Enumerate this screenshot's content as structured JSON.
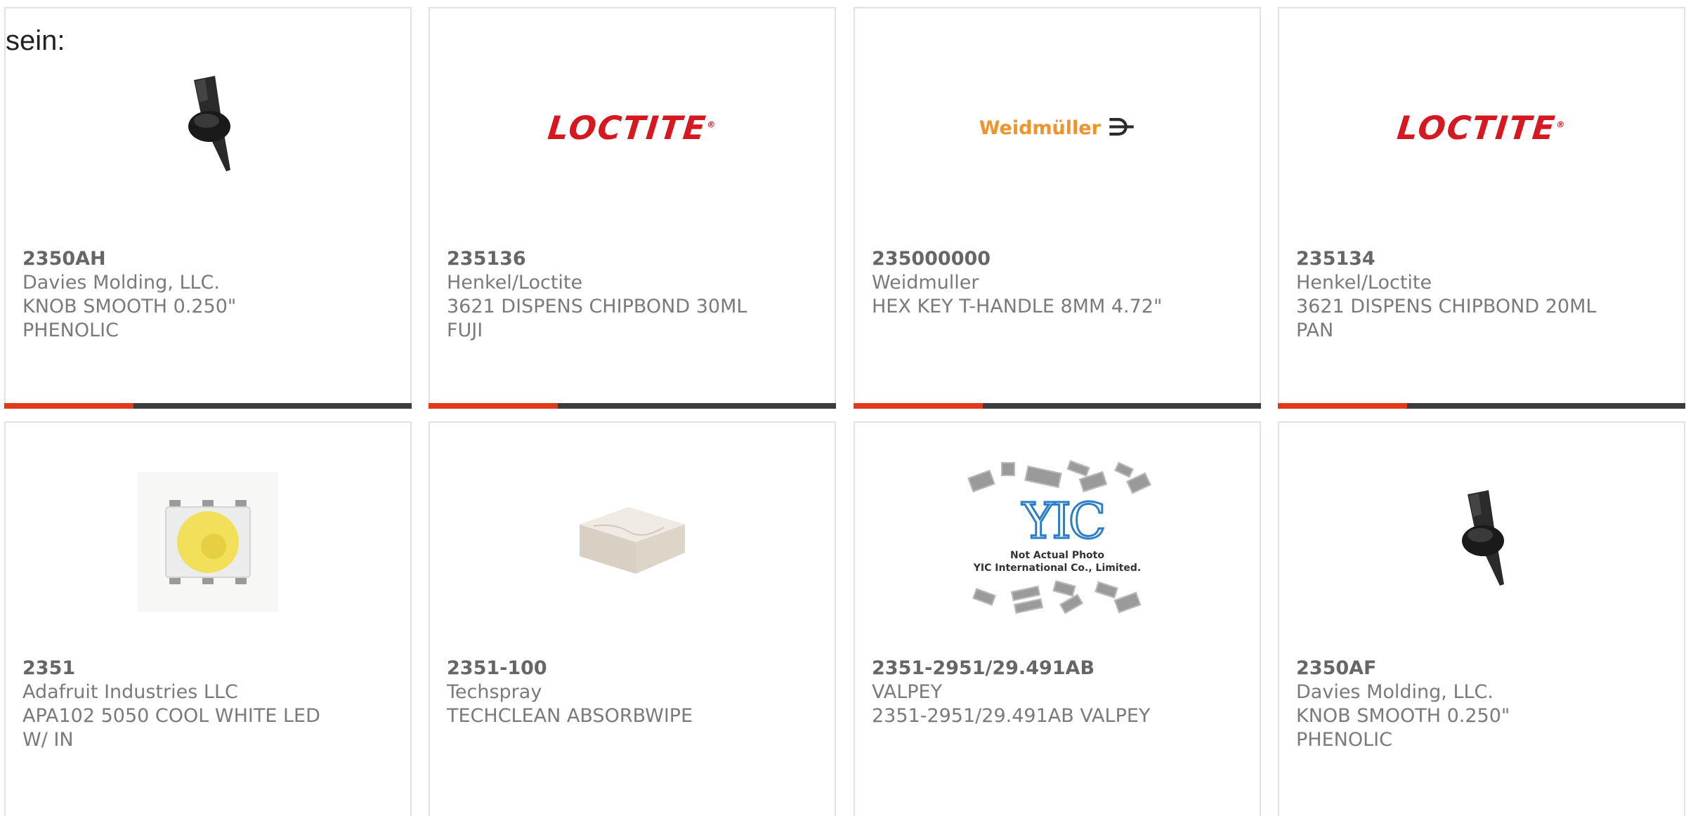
{
  "lead_text": "sein:",
  "colors": {
    "accent_red": "#e0391c",
    "accent_dark": "#3c3c3c",
    "loctite_red": "#d61921",
    "weidmuller_orange": "#f0932a"
  },
  "products": [
    {
      "part_no": "2350AH",
      "manufacturer": "Davies Molding, LLC.",
      "description": "KNOB SMOOTH 0.250\" PHENOLIC",
      "image": "knob-image"
    },
    {
      "part_no": "235136",
      "manufacturer": "Henkel/Loctite",
      "description": "3621 DISPENS CHIPBOND 30ML FUJI",
      "image": "loctite-logo",
      "logo_text": "LOCTITE"
    },
    {
      "part_no": "235000000",
      "manufacturer": "Weidmuller",
      "description": "HEX KEY T-HANDLE 8MM 4.72\"",
      "image": "weidmuller-logo",
      "logo_text": "Weidmüller"
    },
    {
      "part_no": "235134",
      "manufacturer": "Henkel/Loctite",
      "description": "3621 DISPENS CHIPBOND 20ML PAN",
      "image": "loctite-logo",
      "logo_text": "LOCTITE"
    },
    {
      "part_no": "2351",
      "manufacturer": "Adafruit Industries LLC",
      "description": "APA102 5050 COOL WHITE LED W/ IN",
      "image": "led-image"
    },
    {
      "part_no": "2351-100",
      "manufacturer": "Techspray",
      "description": "TECHCLEAN ABSORBWIPE",
      "image": "wipe-image"
    },
    {
      "part_no": "2351-2951/29.491AB",
      "manufacturer": "VALPEY",
      "description": "2351-2951/29.491AB VALPEY",
      "image": "not-actual-photo-placeholder",
      "placeholder_line1": "Not Actual Photo",
      "placeholder_line2": "YIC International Co., Limited.",
      "placeholder_logo": "YIC"
    },
    {
      "part_no": "2350AF",
      "manufacturer": "Davies Molding, LLC.",
      "description": "KNOB SMOOTH 0.250\" PHENOLIC",
      "image": "knob-image"
    }
  ]
}
